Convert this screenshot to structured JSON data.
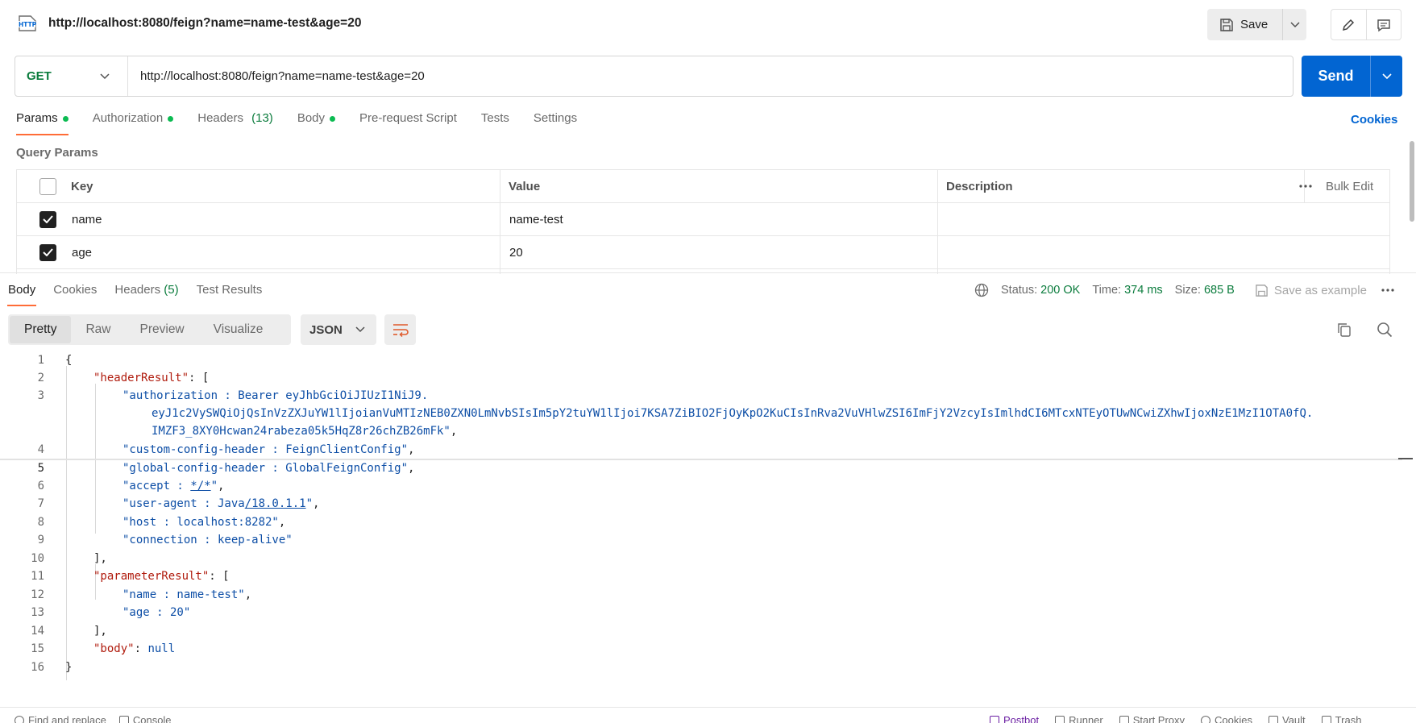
{
  "header": {
    "title": "http://localhost:8080/feign?name=name-test&age=20",
    "icon": "http-icon",
    "save_label": "Save"
  },
  "request": {
    "method": "GET",
    "url": "http://localhost:8080/feign?name=name-test&age=20",
    "send_label": "Send"
  },
  "request_tabs": [
    {
      "label": "Params",
      "dot": true,
      "active": true
    },
    {
      "label": "Authorization",
      "dot": true
    },
    {
      "label": "Headers",
      "count": "(13)"
    },
    {
      "label": "Body",
      "dot": true
    },
    {
      "label": "Pre-request Script"
    },
    {
      "label": "Tests"
    },
    {
      "label": "Settings"
    }
  ],
  "cookies_label": "Cookies",
  "query_params": {
    "title": "Query Params",
    "columns": {
      "key": "Key",
      "value": "Value",
      "description": "Description",
      "bulk_edit": "Bulk Edit"
    },
    "rows": [
      {
        "checked": true,
        "key": "name",
        "value": "name-test",
        "description": ""
      },
      {
        "checked": true,
        "key": "age",
        "value": "20",
        "description": ""
      }
    ]
  },
  "response": {
    "tabs": [
      {
        "label": "Body",
        "active": true
      },
      {
        "label": "Cookies"
      },
      {
        "label": "Headers",
        "count": "(5)"
      },
      {
        "label": "Test Results"
      }
    ],
    "status_label": "Status:",
    "status": "200 OK",
    "time_label": "Time:",
    "time": "374 ms",
    "size_label": "Size:",
    "size": "685 B",
    "save_example": "Save as example",
    "views": [
      "Pretty",
      "Raw",
      "Preview",
      "Visualize"
    ],
    "active_view": "Pretty",
    "format": "JSON"
  },
  "code_lines": [
    "1",
    "2",
    "3",
    "",
    "",
    "4",
    "5",
    "6",
    "7",
    "8",
    "9",
    "10",
    "11",
    "12",
    "13",
    "14",
    "15",
    "16"
  ],
  "json": {
    "open": "{",
    "headerResult_key": "\"headerResult\"",
    "auth_1": "\"authorization : Bearer eyJhbGciOiJIUzI1NiJ9.",
    "auth_2": "eyJ1c2VySWQiOjQsInVzZXJuYW1lIjoianVuMTIzNEB0ZXN0LmNvbSIsIm5pY2tuYW1lIjoi7KSA7ZiBIO2FjOyKpO2KuCIsInRva2VuVHlwZSI6ImFjY2VzcyIsImlhdCI6MTcxNTEyOTUwNCwiZXhwIjoxNzE1MzI1OTA0fQ.",
    "auth_3": "IMZF3_8XY0Hcwan24rabeza05k5HqZ8r26chZB26mFk\"",
    "custom_header": "\"custom-config-header : FeignClientConfig\"",
    "global_header": "\"global-config-header : GlobalFeignConfig\"",
    "accept_pre": "\"accept : ",
    "accept_link": "*/*",
    "accept_post": "\"",
    "ua_pre": "\"user-agent : Java",
    "ua_link": "/18.0.1.1",
    "ua_post": "\"",
    "host": "\"host : localhost:8282\"",
    "connection": "\"connection : keep-alive\"",
    "close_arr": "],",
    "parameterResult_key": "\"parameterResult\"",
    "param_name": "\"name : name-test\"",
    "param_age": "\"age : 20\"",
    "body_key": "\"body\"",
    "null": "null",
    "close": "}"
  },
  "statusbar": {
    "left": [
      "Find and replace",
      "Console"
    ],
    "right": [
      "Postbot",
      "Runner",
      "Start Proxy",
      "Cookies",
      "Vault",
      "Trash"
    ]
  },
  "colors": {
    "accent": "#ff6c37",
    "send": "#0265d2",
    "status_ok": "#0b7c3d",
    "json_key": "#b01b0d",
    "json_string": "#0d4ea6"
  }
}
